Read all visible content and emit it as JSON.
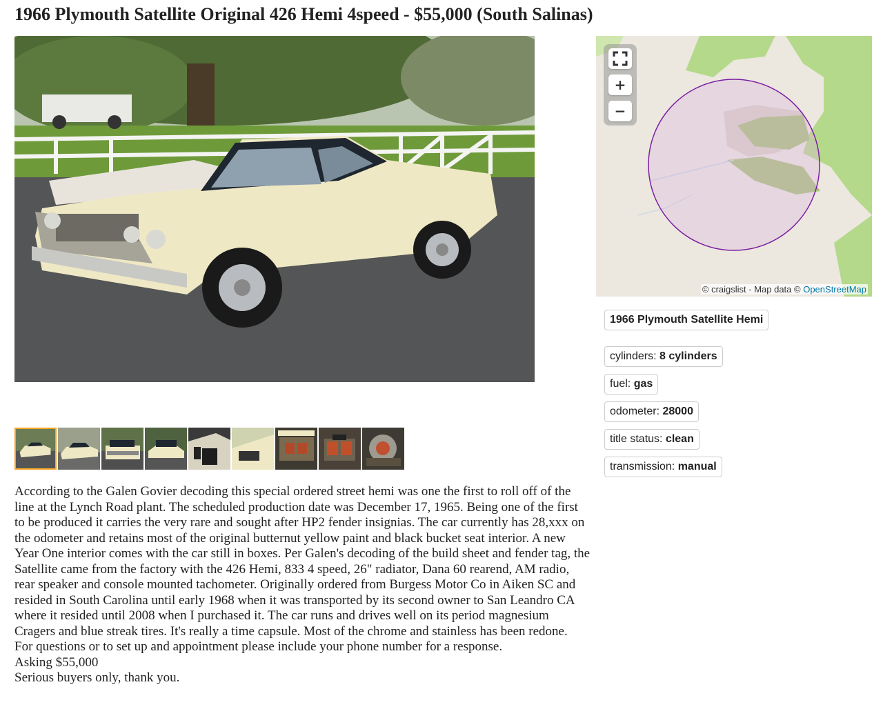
{
  "listing": {
    "title": "1966 Plymouth Satellite Original 426 Hemi 4speed - $55,000 (South Salinas)"
  },
  "gallery": {
    "thumbnail_count": 9,
    "selected_index": 0
  },
  "map": {
    "fullscreen_icon": "fullscreen-icon",
    "zoom_in_label": "+",
    "zoom_out_label": "−",
    "attribution_prefix": "© craigslist - Map data © ",
    "attribution_link": "OpenStreetMap"
  },
  "attributes": {
    "title": "1966 Plymouth Satellite Hemi",
    "items": [
      {
        "label": "cylinders: ",
        "value": "8 cylinders"
      },
      {
        "label": "fuel: ",
        "value": "gas"
      },
      {
        "label": "odometer: ",
        "value": "28000"
      },
      {
        "label": "title status: ",
        "value": "clean"
      },
      {
        "label": "transmission: ",
        "value": "manual"
      }
    ]
  },
  "description": {
    "paragraphs": [
      "According to the Galen Govier decoding this special ordered street hemi was one the first to roll off of the line at the Lynch Road plant. The scheduled production date was December 17, 1965. Being one of the first to be produced it carries the very rare and sought after HP2 fender insignias. The car currently has 28,xxx on the odometer and retains most of the original butternut yellow paint and black bucket seat interior. A new Year One interior comes with the car still in boxes. Per Galen's decoding of the build sheet and fender tag, the Satellite came from the factory with the 426 Hemi, 833 4 speed, 26\" radiator, Dana 60 rearend, AM radio, rear speaker and console mounted tachometer. Originally ordered from Burgess Motor Co in Aiken SC and resided in South Carolina until early 1968 when it was transported by its second owner to San Leandro CA where it resided until 2008 when I purchased it. The car runs and drives well on its period magnesium Cragers and blue streak tires. It's really a time capsule. Most of the chrome and stainless has been redone.",
      "For questions or to set up and appointment please include your phone number for a response.",
      "Asking $55,000",
      "Serious buyers only, thank you."
    ]
  },
  "colors": {
    "selected_thumb_border": "#f5a623",
    "map_circle": "#7b1fa2",
    "map_green": "#b5d98a",
    "attribution_link": "#0078a8"
  }
}
